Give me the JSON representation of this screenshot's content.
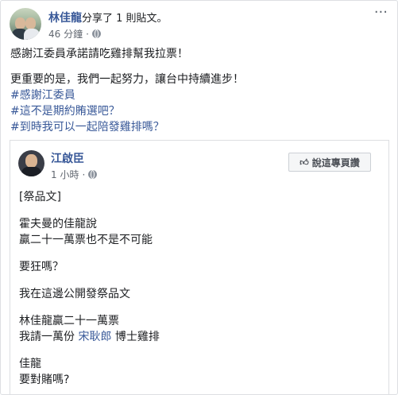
{
  "post": {
    "author": "林佳龍",
    "action": "分享了 1 則貼文。",
    "time": "46 分鐘",
    "more": "···",
    "message_line1": "感謝江委員承諾請吃雞排幫我拉票！",
    "message_line2": "更重要的是，我們一起努力，讓台中持續進步！",
    "hashtags": [
      "#感謝江委員",
      "#這不是期約賄選吧？",
      "#到時我可以一起陪發雞排嗎？"
    ]
  },
  "shared_post": {
    "author": "江啟臣",
    "time": "1 小時",
    "follow_button": "說這專頁讚",
    "lines": {
      "p1": "[祭品文]",
      "p2a": "霍夫曼的佳龍說",
      "p2b": "贏二十一萬票也不是不可能",
      "p3": "要狂嗎？",
      "p4": "我在這邊公開發祭品文",
      "p5a": "林佳龍贏二十一萬票",
      "p5b_pre": "我請一萬份",
      "p5b_mention": "宋耿郎",
      "p5b_post": "博士雞排",
      "p6a": "佳龍",
      "p6b": "要對賭嗎?"
    }
  },
  "colors": {
    "link": "#385898",
    "text": "#1c1e21",
    "meta": "#616770"
  }
}
